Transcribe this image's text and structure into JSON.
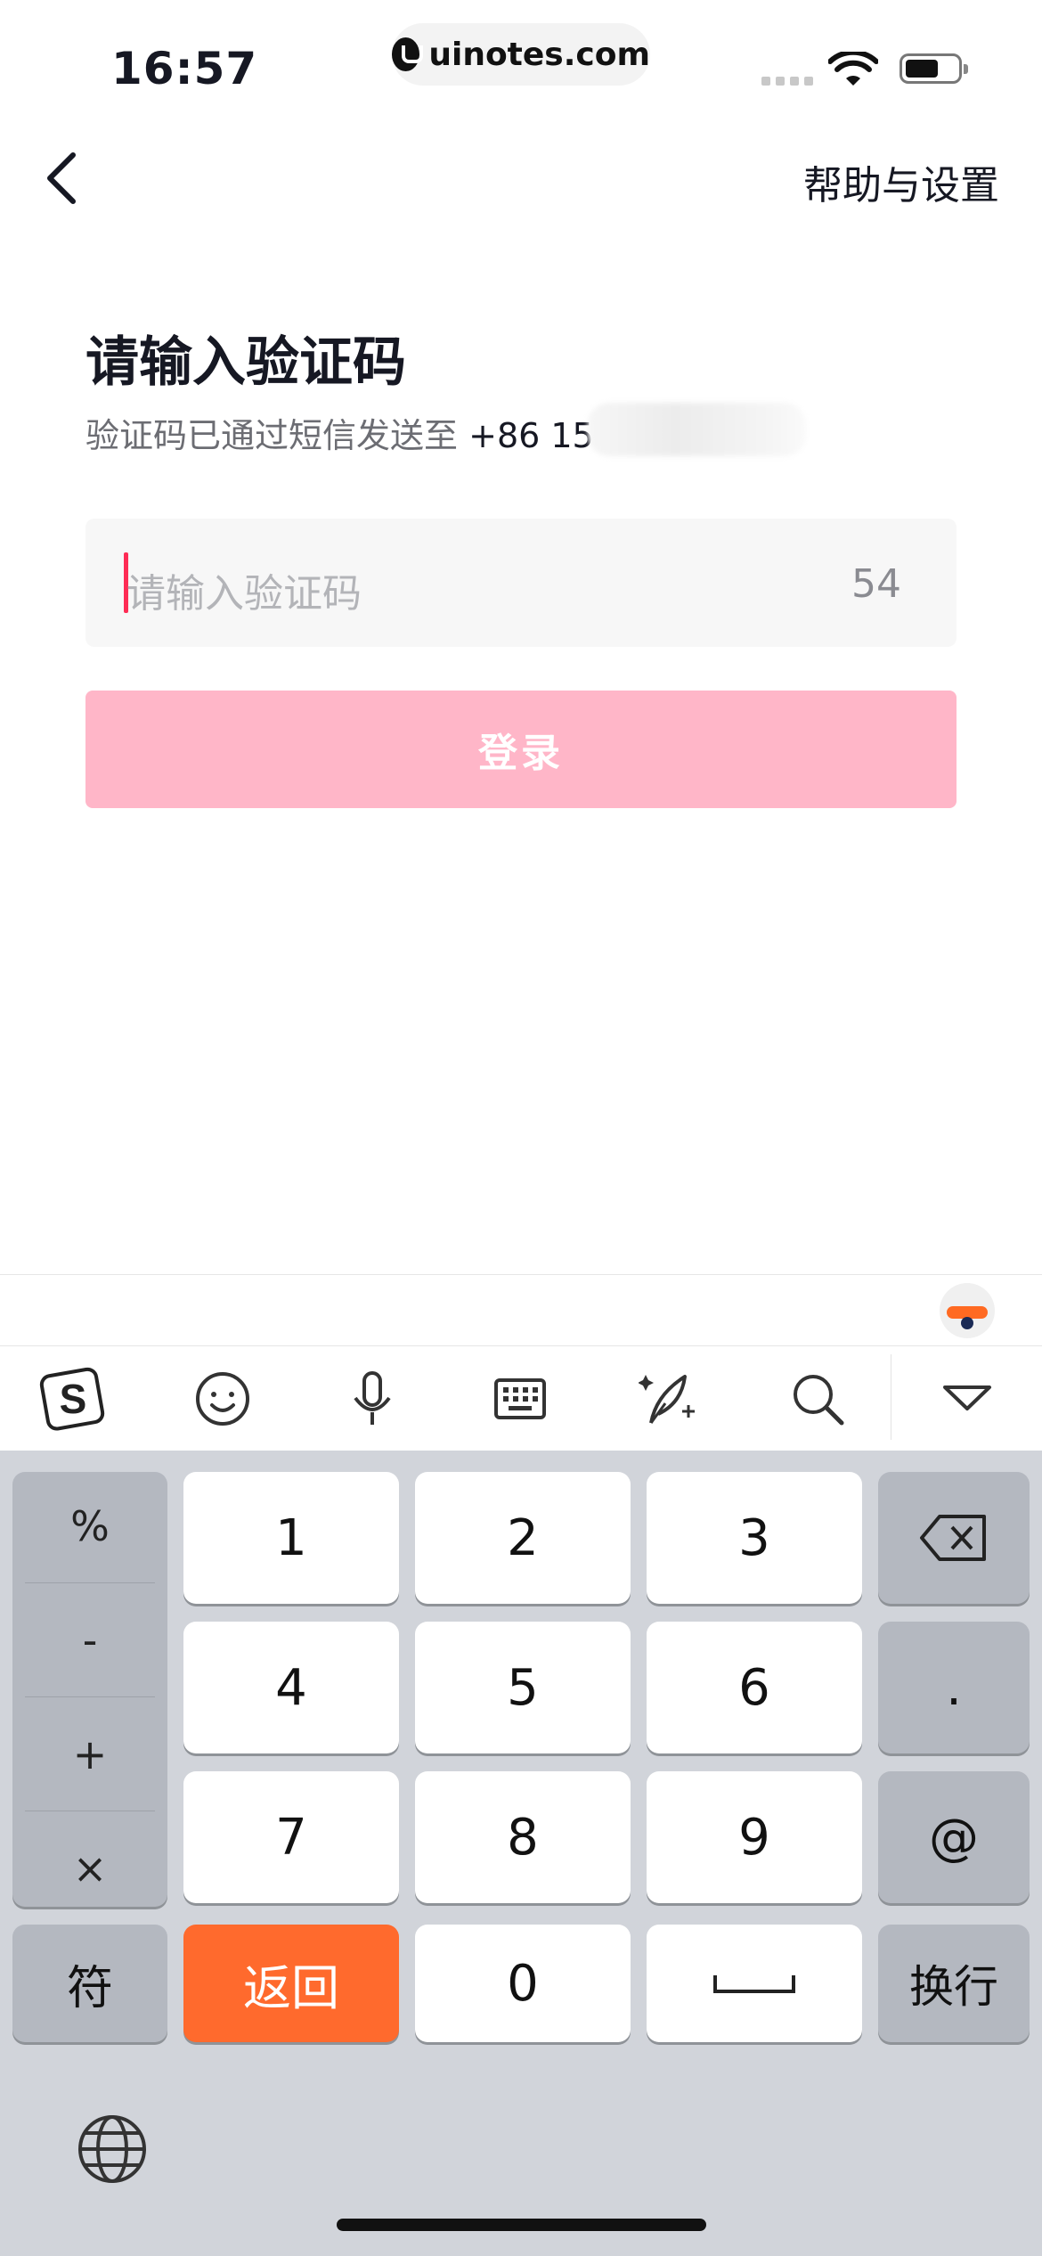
{
  "status_bar": {
    "time": "16:57",
    "url": "uinotes.com"
  },
  "nav": {
    "help_label": "帮助与设置"
  },
  "page": {
    "title": "请输入验证码",
    "subtitle_prefix": "验证码已通过短信发送至",
    "phone_visible": "+86 15"
  },
  "code_input": {
    "placeholder": "请输入验证码",
    "countdown": "54"
  },
  "login_button": {
    "label": "登录"
  },
  "colors": {
    "accent": "#fe2c55",
    "button_disabled": "#ffb6c8",
    "keyboard_return": "#ff6a2d",
    "keyboard_bg": "#d1d4da"
  },
  "keyboard": {
    "toolbar_icons": [
      "sogou-logo-icon",
      "emoji-icon",
      "microphone-icon",
      "keyboard-icon",
      "quill-icon",
      "search-icon",
      "collapse-keyboard-icon"
    ],
    "symbols": [
      "%",
      "-",
      "+",
      "×"
    ],
    "digits": [
      "1",
      "2",
      "3",
      "4",
      "5",
      "6",
      "7",
      "8",
      "9"
    ],
    "zero": "0",
    "dot": ".",
    "at": "@",
    "fu_label": "符",
    "return_label": "返回",
    "newline_label": "换行"
  }
}
